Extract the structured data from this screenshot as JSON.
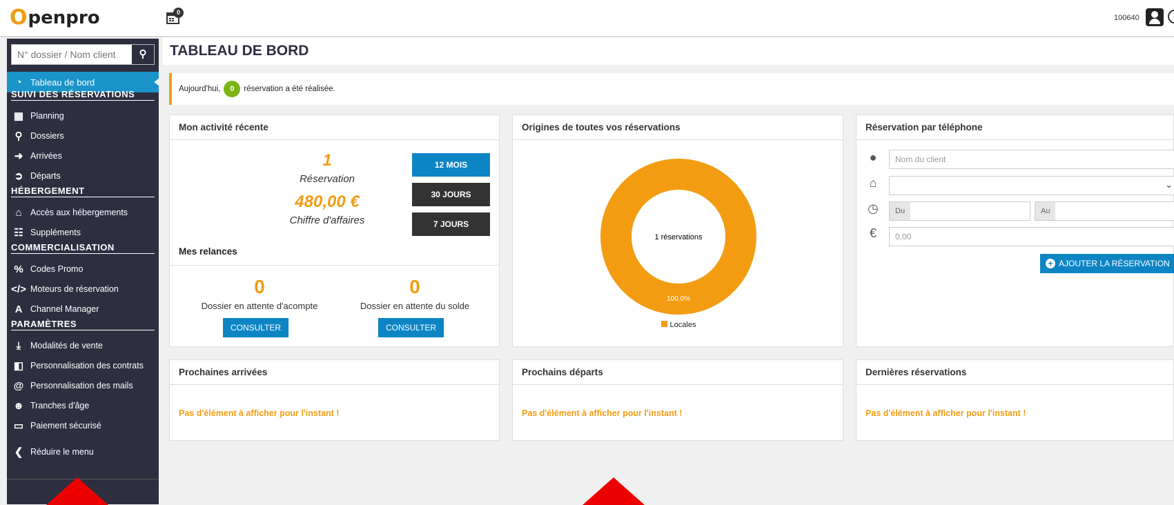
{
  "header": {
    "logo_text": "penpro",
    "logo_o": "O",
    "calendar_badge": "0",
    "user_id": "100640"
  },
  "sidebar": {
    "search_placeholder": "N° dossier / Nom client",
    "active": "Tableau de bord",
    "sections": {
      "suivi": "SUIVI DES RÉSERVATIONS",
      "hebergement": "HÉBERGEMENT",
      "commercialisation": "COMMERCIALISATION",
      "parametres": "PARAMÈTRES"
    },
    "items": {
      "planning": "Planning",
      "dossiers": "Dossiers",
      "arrivees": "Arrivées",
      "departs": "Départs",
      "acces": "Accès aux hébergements",
      "supplements": "Suppléments",
      "codes_promo": "Codes Promo",
      "moteurs": "Moteurs de réservation",
      "channel": "Channel Manager",
      "modalites": "Modalités de vente",
      "contrats": "Personnalisation des contrats",
      "mails": "Personnalisation des mails",
      "tranches": "Tranches d'âge",
      "paiement": "Paiement sécurisé",
      "reduire": "Réduire le menu"
    }
  },
  "main": {
    "title": "TABLEAU DE BORD",
    "notice": {
      "prefix": "Aujourd'hui,",
      "count": "0",
      "suffix": "réservation a été réalisée."
    }
  },
  "activity": {
    "title": "Mon activité récente",
    "reservations": "1",
    "reservations_label": "Réservation",
    "ca": "480,00 €",
    "ca_label": "Chiffre d'affaires",
    "btn_12": "12 MOIS",
    "btn_30": "30 JOURS",
    "btn_7": "7 JOURS",
    "relances_title": "Mes relances",
    "acompte_count": "0",
    "acompte_label": "Dossier en attente d'acompte",
    "solde_count": "0",
    "solde_label": "Dossier en attente du solde",
    "consult": "CONSULTER"
  },
  "origins": {
    "title": "Origines de toutes vos réservations",
    "center": "1 réservations",
    "pct": "100.0%",
    "legend": "Locales"
  },
  "chart_data": {
    "type": "pie",
    "categories": [
      "Locales"
    ],
    "values": [
      100.0
    ],
    "colors": [
      "#f39c12"
    ]
  },
  "phone": {
    "title": "Réservation par téléphone",
    "client_placeholder": "Nom du client",
    "du": "Du",
    "au": "Au",
    "amount_placeholder": "0,00",
    "add_button": "AJOUTER LA RÉSERVATION"
  },
  "arrivals": {
    "title": "Prochaines arrivées",
    "empty": "Pas d'élément à afficher pour l'instant !"
  },
  "departures": {
    "title": "Prochains départs",
    "empty": "Pas d'élément à afficher pour l'instant !"
  },
  "latest": {
    "title": "Dernières réservations",
    "empty": "Pas d'élément à afficher pour l'instant !"
  },
  "colors": {
    "accent": "#f39c12",
    "primary": "#0d85c4",
    "sidebar": "#2d2f40",
    "green": "#7cb518"
  }
}
